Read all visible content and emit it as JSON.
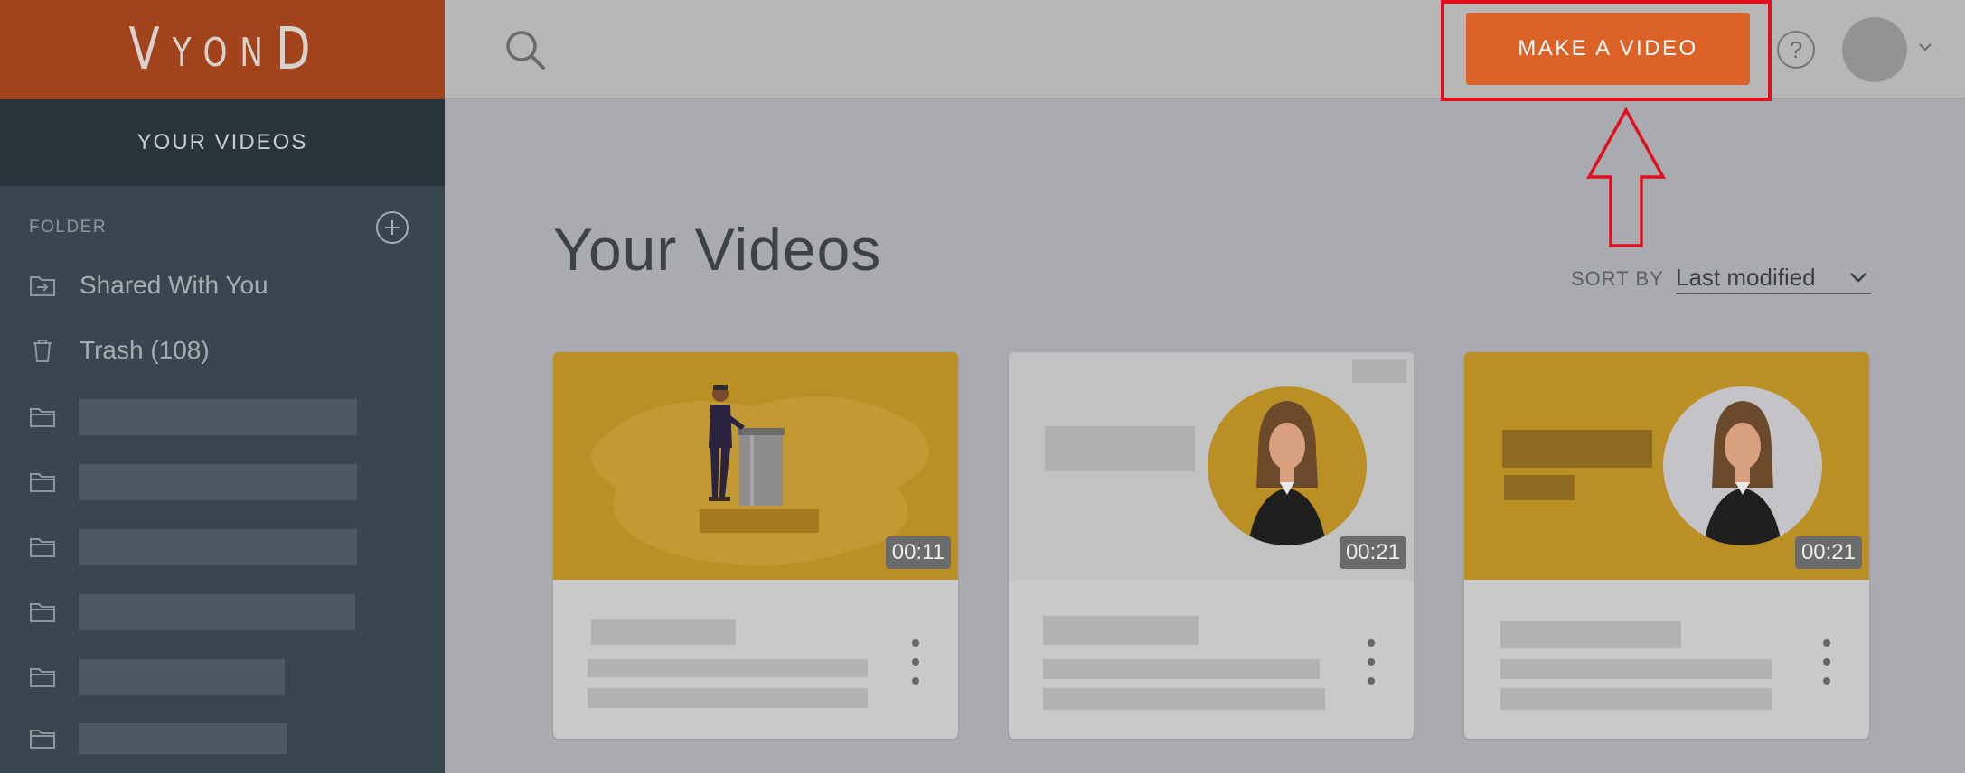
{
  "app": {
    "logo_text": [
      "V",
      "Y",
      "O",
      "N",
      "D"
    ]
  },
  "sidebar": {
    "tab_label": "YOUR VIDEOS",
    "folder_header": "FOLDER",
    "items": [
      {
        "label": "Shared With You",
        "icon": "shared-folder-icon"
      },
      {
        "label": "Trash (108)",
        "icon": "trash-icon"
      }
    ],
    "redacted_folders": 6
  },
  "topbar": {
    "make_video_label": "MAKE A VIDEO",
    "help_glyph": "?"
  },
  "main": {
    "title": "Your Videos",
    "sort_label": "SORT BY",
    "sort_value": "Last modified"
  },
  "cards": [
    {
      "duration": "00:11"
    },
    {
      "duration": "00:21"
    },
    {
      "duration": "00:21"
    }
  ],
  "colors": {
    "brand": "#a3431c",
    "cta": "#dc6228",
    "highlight": "#e0101e",
    "sidebar": "#384650"
  }
}
